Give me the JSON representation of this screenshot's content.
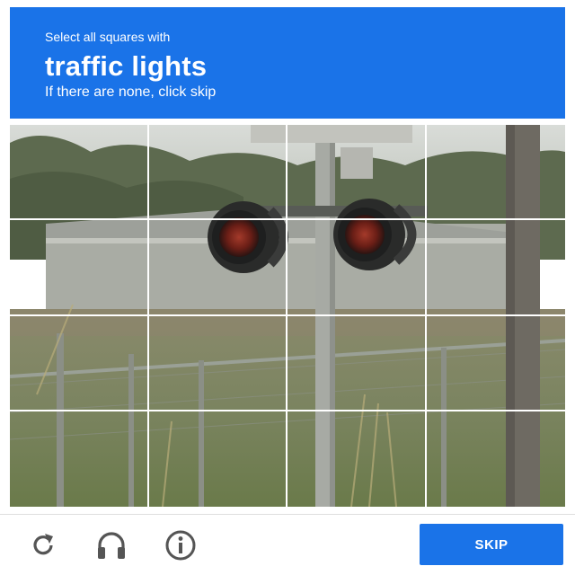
{
  "header": {
    "instruction": "Select all squares with",
    "target": "traffic lights",
    "hint": "If there are none, click skip",
    "color": "#1a73e8"
  },
  "grid": {
    "rows": 4,
    "cols": 4
  },
  "footer": {
    "icons": [
      "refresh-icon",
      "headphones-icon",
      "info-icon"
    ],
    "skip_label": "SKIP"
  }
}
